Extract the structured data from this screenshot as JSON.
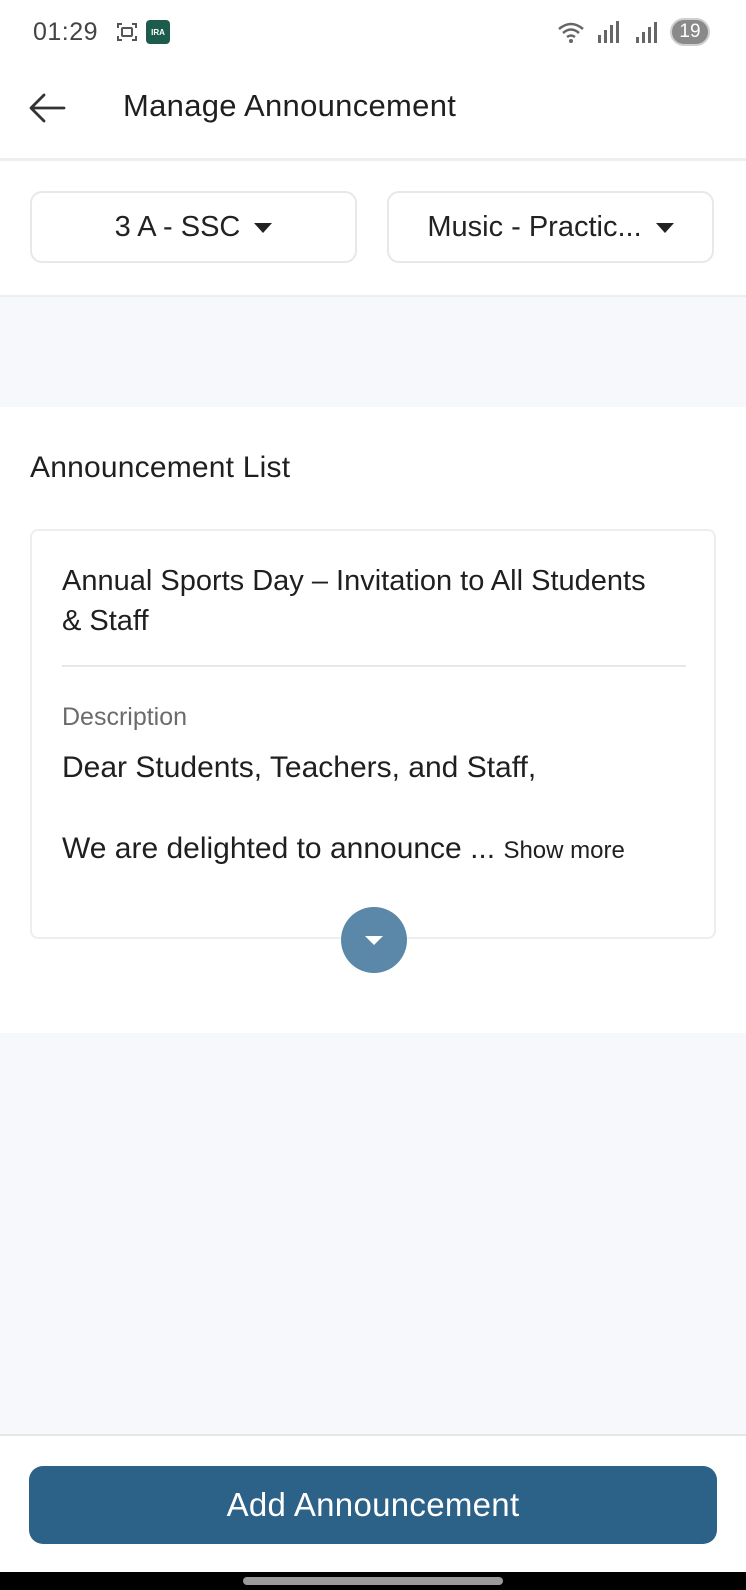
{
  "status_bar": {
    "time": "01:29",
    "app_icon_text": "IRA",
    "battery": "19",
    "icons": [
      "screenshot-icon",
      "app-icon",
      "wifi-icon",
      "signal-icon",
      "signal-icon",
      "battery-icon"
    ]
  },
  "header": {
    "title": "Manage Announcement",
    "back_icon": "arrow-left-icon"
  },
  "filters": {
    "class_value": "3 A - SSC",
    "subject_value": "Music - Practic..."
  },
  "list": {
    "section_title": "Announcement List",
    "items": [
      {
        "title": "Annual Sports Day – Invitation to All Students & Staff",
        "description_label": "Description",
        "description_line1": "Dear Students, Teachers, and Staff,",
        "description_line2": "We are delighted to announce ...",
        "show_more": "Show more"
      }
    ]
  },
  "footer": {
    "add_button_label": "Add Announcement"
  },
  "colors": {
    "primary": "#2c6188",
    "expand_button": "#5b88a8",
    "page_band": "#f6f8fc"
  }
}
